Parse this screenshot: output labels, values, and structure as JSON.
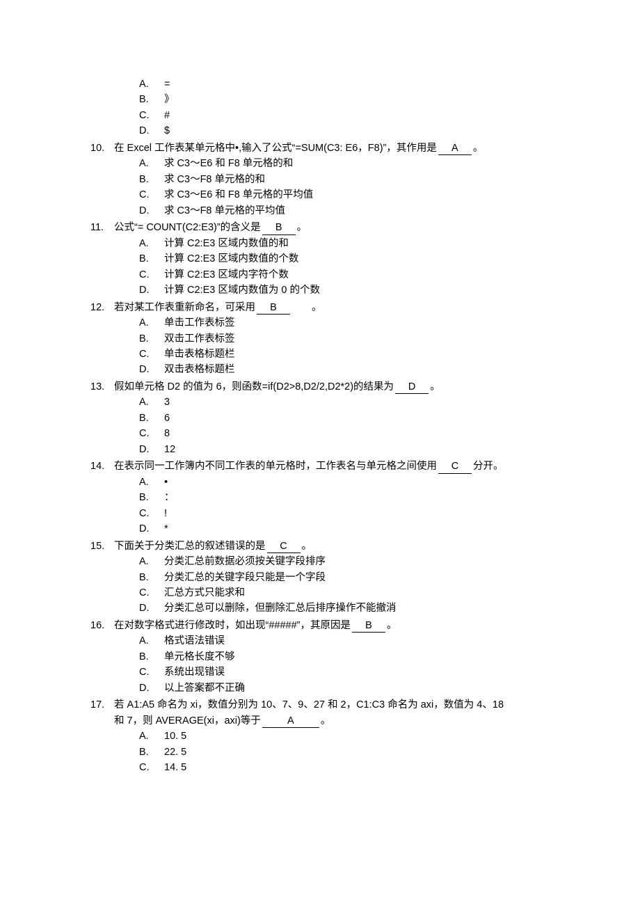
{
  "orphan_options": [
    {
      "letter": "A.",
      "text": "="
    },
    {
      "letter": "B.",
      "text": "》"
    },
    {
      "letter": "C.",
      "text": "#"
    },
    {
      "letter": "D.",
      "text": "$"
    }
  ],
  "questions": [
    {
      "num": "10.",
      "pre": "在 Excel 工作表某单元格中•,输入了公式“=SUM(C3: E6，F8)”，其作用是",
      "ans": "A",
      "post": "。",
      "opts": [
        {
          "letter": "A.",
          "text": "求 C3～E6 和 F8 单元格的和"
        },
        {
          "letter": "B.",
          "text": "求 C3～F8 单元格的和"
        },
        {
          "letter": "C.",
          "text": "求 C3～E6 和 F8 单元格的平均值"
        },
        {
          "letter": "D.",
          "text": "求 C3～F8 单元格的平均值"
        }
      ]
    },
    {
      "num": "11.",
      "pre": "公式“= COUNT(C2:E3)”的含义是",
      "ans": "B",
      "post": "。",
      "opts": [
        {
          "letter": "A.",
          "text": "计算 C2:E3 区域内数值的和"
        },
        {
          "letter": "B.",
          "text": "计算 C2:E3 区域内数值的个数"
        },
        {
          "letter": "C.",
          "text": "计算 C2:E3 区域内字符个数"
        },
        {
          "letter": "D.",
          "text": "计算 C2:E3 区域内数值为 0 的个数"
        }
      ]
    },
    {
      "num": "12.",
      "pre": "若对某工作表重新命名，可采用",
      "ans": "B",
      "post": "　　。",
      "opts": [
        {
          "letter": "A.",
          "text": "单击工作表标签"
        },
        {
          "letter": "B.",
          "text": "双击工作表标签"
        },
        {
          "letter": "C.",
          "text": "单击表格标题栏"
        },
        {
          "letter": "D.",
          "text": "双击表格标题栏"
        }
      ]
    },
    {
      "num": "13.",
      "pre": "假如单元格 D2 的值为 6，则函数=if(D2>8,D2/2,D2*2)的结果为",
      "ans": "D",
      "post": "。",
      "opts": [
        {
          "letter": "A.",
          "text": "3"
        },
        {
          "letter": "B.",
          "text": "6"
        },
        {
          "letter": "C.",
          "text": "8"
        },
        {
          "letter": "D.",
          "text": "12"
        }
      ]
    },
    {
      "num": "14.",
      "pre": "在表示同一工作簿内不同工作表的单元格时，工作表名与单元格之间使用",
      "ans": "C",
      "post": "分开。",
      "opts": [
        {
          "letter": "A.",
          "text": "•"
        },
        {
          "letter": "B.",
          "text": "："
        },
        {
          "letter": "C.",
          "text": "!"
        },
        {
          "letter": "D.",
          "text": "*"
        }
      ]
    },
    {
      "num": "15.",
      "pre": "下面关于分类汇总的叙述错误的是",
      "ans": "C",
      "post": "。",
      "opts": [
        {
          "letter": "A.",
          "text": "分类汇总前数据必须按关键字段排序"
        },
        {
          "letter": "B.",
          "text": "分类汇总的关键字段只能是一个字段"
        },
        {
          "letter": "C.",
          "text": "汇总方式只能求和"
        },
        {
          "letter": "D.",
          "text": "分类汇总可以删除，但删除汇总后排序操作不能撤消"
        }
      ]
    },
    {
      "num": "16.",
      "pre": "在对数字格式进行修改时，如出现“#####”，其原因是",
      "ans": "B",
      "post": "。",
      "opts": [
        {
          "letter": "A.",
          "text": "格式语法错误"
        },
        {
          "letter": "B.",
          "text": "单元格长度不够"
        },
        {
          "letter": "C.",
          "text": "系统出现错误"
        },
        {
          "letter": "D.",
          "text": "以上答案都不正确"
        }
      ]
    },
    {
      "num": "17.",
      "pre": "若 A1:A5 命名为 xi，数值分别为 10、7、9、27 和 2，C1:C3 命名为 axi，数值为 4、18",
      "cont_pre": "和 7，则 AVERAGE(xi，axi)等于",
      "ans": "A",
      "post": "。",
      "opts": [
        {
          "letter": "A.",
          "text": "10. 5"
        },
        {
          "letter": "B.",
          "text": "22. 5"
        },
        {
          "letter": "C.",
          "text": " 14. 5"
        }
      ]
    }
  ]
}
